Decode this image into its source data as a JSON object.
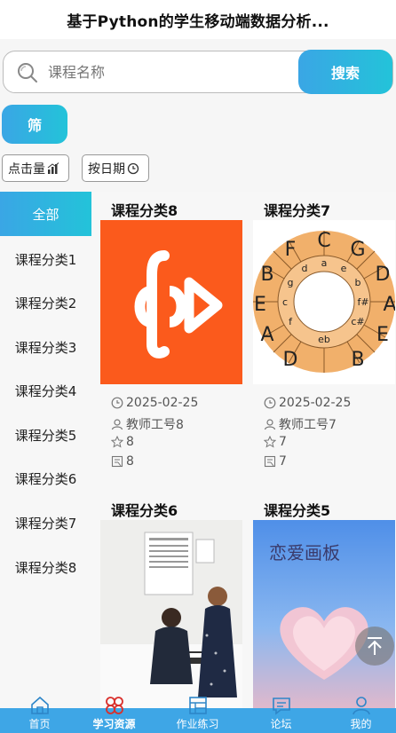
{
  "app": {
    "title": "基于Python的学生移动端数据分析..."
  },
  "search": {
    "placeholder": "课程名称",
    "button_label": "搜索"
  },
  "filter": {
    "label": "筛"
  },
  "sort": {
    "by_clicks": "点击量",
    "by_date": "按日期"
  },
  "categories": {
    "all": "全部",
    "items": [
      "课程分类1",
      "课程分类2",
      "课程分类3",
      "课程分类4",
      "课程分类5",
      "课程分类6",
      "课程分类7",
      "课程分类8"
    ]
  },
  "courses": [
    {
      "name": "课程分类8",
      "date": "2025-02-25",
      "teacher": "教师工号8",
      "likes": "8",
      "collects": "8",
      "cover": "red-logo"
    },
    {
      "name": "课程分类7",
      "date": "2025-02-25",
      "teacher": "教师工号7",
      "likes": "7",
      "collects": "7",
      "cover": "circle-of-fifths"
    },
    {
      "name": "课程分类6",
      "cover": "piano-photo"
    },
    {
      "name": "课程分类5",
      "cover": "heart-cloud"
    }
  ],
  "cover_text": {
    "heart_cloud_title": "恋爱画板"
  },
  "tabbar": {
    "items": [
      {
        "label": "首页",
        "icon": "home-icon"
      },
      {
        "label": "学习资源",
        "icon": "resource-icon"
      },
      {
        "label": "作业练习",
        "icon": "homework-icon"
      },
      {
        "label": "论坛",
        "icon": "forum-icon"
      },
      {
        "label": "我的",
        "icon": "user-icon"
      }
    ]
  },
  "colors": {
    "accent_start": "#3aa6e5",
    "accent_end": "#23c3d9",
    "tab_bg": "#3ea6e6",
    "active_tab_icon": "#d9302c"
  }
}
